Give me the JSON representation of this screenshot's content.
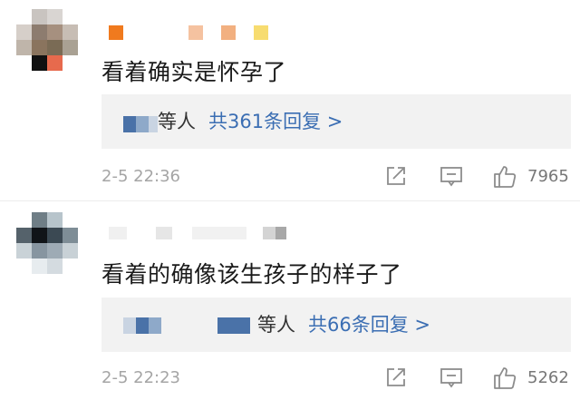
{
  "comments": [
    {
      "text": "看着确实是怀孕了",
      "reply": {
        "who": "等人",
        "link": "共361条回复 >"
      },
      "time": "2-5 22:36",
      "likes": "7965"
    },
    {
      "text": "看着的确像该生孩子的样子了",
      "reply": {
        "who": "等人",
        "link": "共66条回复 >"
      },
      "time": "2-5 22:23",
      "likes": "5262"
    }
  ],
  "icons": [
    "share-icon",
    "comment-icon",
    "like-thumb-icon"
  ]
}
